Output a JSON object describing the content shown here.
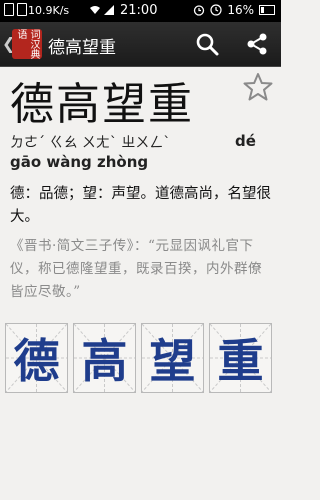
{
  "status": {
    "network_speed": "10.9K/s",
    "time": "21:00",
    "battery": "16%"
  },
  "appbar": {
    "logo_text": "词汉典语",
    "title": "德高望重",
    "icons": [
      "back-icon",
      "search-icon",
      "share-icon"
    ]
  },
  "entry": {
    "headword": "德高望重",
    "zhuyin": "ㄉㄜˊ  ㄍㄠ  ㄨㄤˋ  ㄓㄨㄥˋ",
    "pinyin_a": "dé",
    "pinyin_b": "gāo wàng zhòng",
    "definition": "德：品德；望：声望。道德高尚，名望很大。",
    "quote": "《晋书·简文三子传》：“元显因讽礼官下仪，称已德隆望重，既录百揆，内外群僚皆应尽敬。”",
    "characters": [
      "德",
      "高",
      "望",
      "重"
    ]
  },
  "colors": {
    "accent": "#b3261e",
    "char_blue": "#1f3d8c",
    "quote_gray": "#8a8a8a",
    "appbar_bg": "#1b1b1b"
  }
}
